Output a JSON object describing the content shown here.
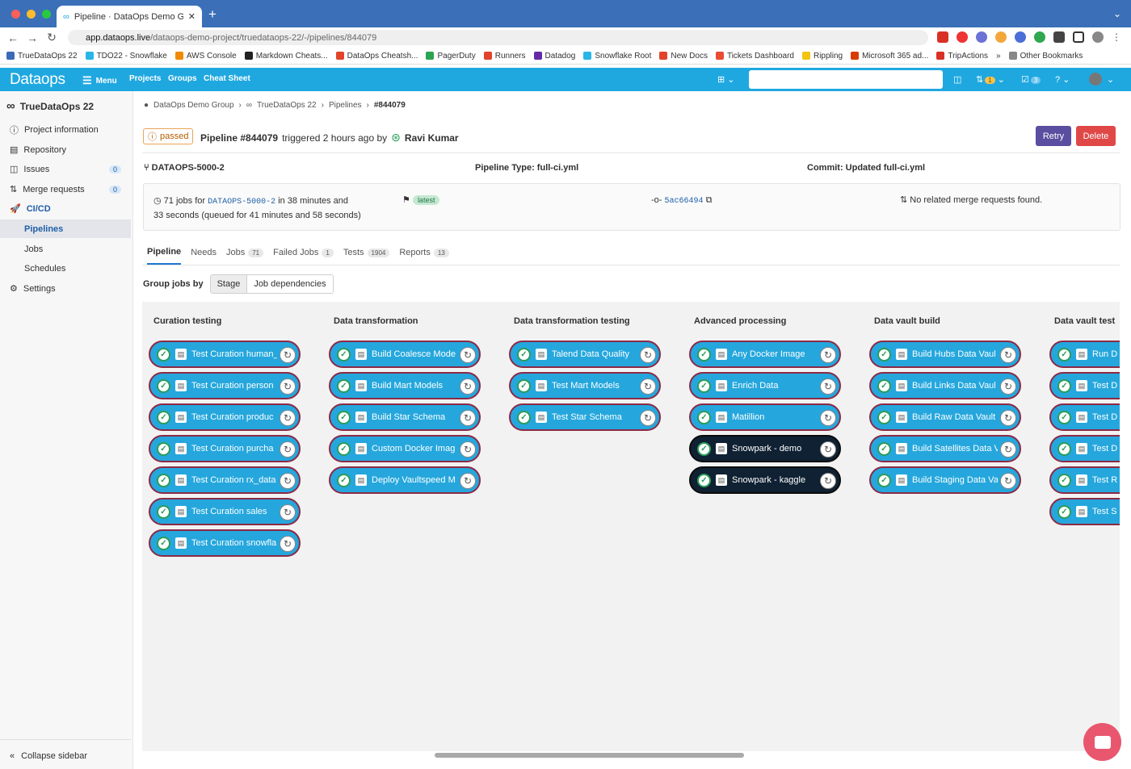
{
  "browser": {
    "tab_title": "Pipeline · DataOps Demo Grou",
    "url_host": "app.dataops.live",
    "url_path": "/dataops-demo-project/truedataops-22/-/pipelines/844079",
    "bookmarks": [
      "TrueDataOps 22",
      "TDO22 - Snowflake",
      "AWS Console",
      "Markdown Cheats...",
      "DataOps Cheatsh...",
      "PagerDuty",
      "Runners",
      "Datadog",
      "Snowflake Root",
      "New Docs",
      "Tickets Dashboard",
      "Rippling",
      "Microsoft 365 ad...",
      "TripActions",
      "»",
      "Other Bookmarks"
    ]
  },
  "topnav": {
    "logo": "Dataops",
    "menu": "Menu",
    "projects": "Projects",
    "groups": "Groups",
    "cheat": "Cheat Sheet",
    "mr_count": "1",
    "todo_count": "3"
  },
  "sidebar": {
    "project": "TrueDataOps 22",
    "items": [
      {
        "label": "Project information",
        "icon": "info-icon"
      },
      {
        "label": "Repository",
        "icon": "repository-icon"
      },
      {
        "label": "Issues",
        "badge": "0",
        "icon": "issues-icon"
      },
      {
        "label": "Merge requests",
        "badge": "0",
        "icon": "merge-request-icon"
      },
      {
        "label": "CI/CD",
        "icon": "rocket-icon"
      },
      {
        "label": "Pipelines"
      },
      {
        "label": "Jobs"
      },
      {
        "label": "Schedules"
      },
      {
        "label": "Settings",
        "icon": "settings-icon"
      }
    ],
    "collapse": "Collapse sidebar"
  },
  "breadcrumb": [
    "DataOps Demo Group",
    "TrueDataOps 22",
    "Pipelines",
    "#844079"
  ],
  "header": {
    "status": "passed",
    "pipeline": "Pipeline #844079",
    "triggered": "triggered 2 hours ago by",
    "user": "Ravi Kumar",
    "retry": "Retry",
    "delete": "Delete"
  },
  "info": {
    "branch": "DATAOPS-5000-2",
    "type": "Pipeline Type: full-ci.yml",
    "commit": "Commit: Updated full-ci.yml",
    "jobs_a": "71 jobs for",
    "jobs_branch": "DATAOPS-5000-2",
    "jobs_b": "in 38 minutes and",
    "jobs_c": "33 seconds (queued for 41 minutes and 58 seconds)",
    "latest": "latest",
    "sha": "5ac66494",
    "mr": "No related merge requests found."
  },
  "tabs": [
    {
      "label": "Pipeline"
    },
    {
      "label": "Needs"
    },
    {
      "label": "Jobs",
      "count": "71"
    },
    {
      "label": "Failed Jobs",
      "count": "1"
    },
    {
      "label": "Tests",
      "count": "1904"
    },
    {
      "label": "Reports",
      "count": "13"
    }
  ],
  "group": {
    "label": "Group jobs by",
    "stage": "Stage",
    "deps": "Job dependencies"
  },
  "stages": [
    {
      "title": "Curation testing",
      "jobs": [
        {
          "name": "Test Curation human_r",
          "dark": false
        },
        {
          "name": "Test Curation person",
          "dark": false
        },
        {
          "name": "Test Curation produc",
          "dark": false
        },
        {
          "name": "Test Curation purcha",
          "dark": false
        },
        {
          "name": "Test Curation rx_data",
          "dark": false
        },
        {
          "name": "Test Curation sales",
          "dark": false
        },
        {
          "name": "Test Curation snowfla",
          "dark": false
        }
      ]
    },
    {
      "title": "Data transformation",
      "jobs": [
        {
          "name": "Build Coalesce Mode",
          "dark": false
        },
        {
          "name": "Build Mart Models",
          "dark": false
        },
        {
          "name": "Build Star Schema",
          "dark": false
        },
        {
          "name": "Custom Docker Imag",
          "dark": false
        },
        {
          "name": "Deploy Vaultspeed M",
          "dark": false
        }
      ]
    },
    {
      "title": "Data transformation testing",
      "jobs": [
        {
          "name": "Talend Data Quality",
          "dark": false
        },
        {
          "name": "Test Mart Models",
          "dark": false
        },
        {
          "name": "Test Star Schema",
          "dark": false
        }
      ]
    },
    {
      "title": "Advanced processing",
      "jobs": [
        {
          "name": "Any Docker Image",
          "dark": false
        },
        {
          "name": "Enrich Data",
          "dark": false
        },
        {
          "name": "Matillion",
          "dark": false
        },
        {
          "name": "Snowpark - demo",
          "dark": true
        },
        {
          "name": "Snowpark - kaggle",
          "dark": true
        }
      ]
    },
    {
      "title": "Data vault build",
      "jobs": [
        {
          "name": "Build Hubs Data Vaul",
          "dark": false
        },
        {
          "name": "Build Links Data Vaul",
          "dark": false
        },
        {
          "name": "Build Raw Data Vault",
          "dark": false
        },
        {
          "name": "Build Satellites Data V",
          "dark": false
        },
        {
          "name": "Build Staging Data Va",
          "dark": false
        }
      ]
    },
    {
      "title": "Data vault test",
      "jobs": [
        {
          "name": "Run D",
          "dark": false
        },
        {
          "name": "Test D",
          "dark": false
        },
        {
          "name": "Test D",
          "dark": false
        },
        {
          "name": "Test D",
          "dark": false
        },
        {
          "name": "Test R",
          "dark": false
        },
        {
          "name": "Test S",
          "dark": false
        }
      ]
    }
  ]
}
